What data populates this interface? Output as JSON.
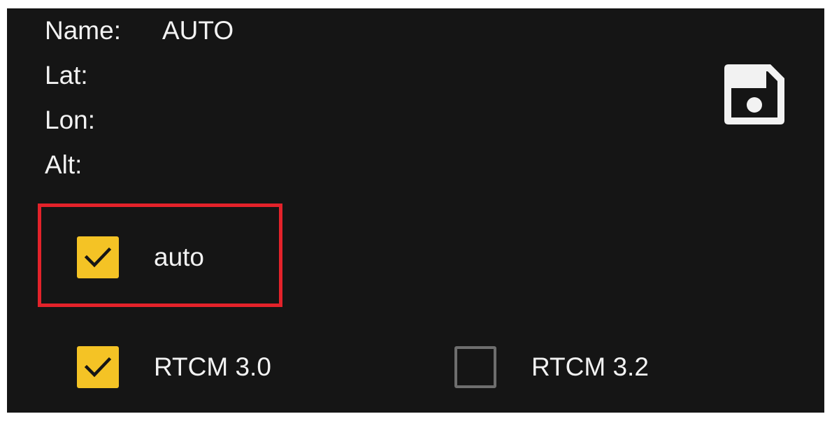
{
  "info": {
    "name_label": "Name:",
    "name_value": "AUTO",
    "lat_label": "Lat:",
    "lon_label": "Lon:",
    "alt_label": "Alt:"
  },
  "save_button": {
    "icon": "save-icon"
  },
  "options": {
    "auto": {
      "label": "auto",
      "checked": true
    },
    "rtcm30": {
      "label": "RTCM 3.0",
      "checked": true
    },
    "rtcm32": {
      "label": "RTCM 3.2",
      "checked": false
    }
  },
  "colors": {
    "background": "#151515",
    "text": "#f2f2f2",
    "checkbox_checked": "#f4c325",
    "checkbox_unchecked_border": "#6e6e6e",
    "highlight": "#e3222a"
  }
}
